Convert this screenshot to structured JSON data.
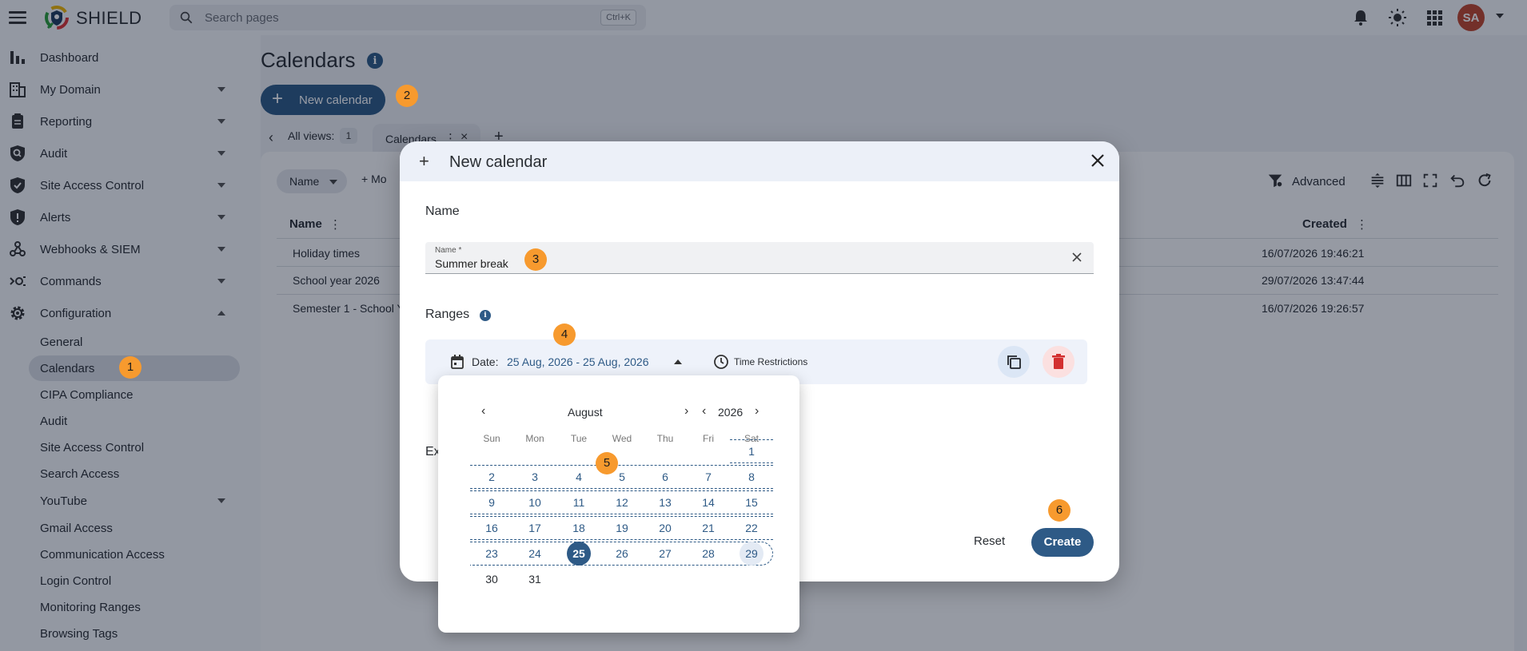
{
  "app": {
    "brand": "SHIELD",
    "avatar_initials": "SA"
  },
  "search": {
    "placeholder": "Search pages",
    "shortcut": "Ctrl+K"
  },
  "sidebar": {
    "items": [
      {
        "label": "Dashboard",
        "icon": "bar-chart-icon"
      },
      {
        "label": "My Domain",
        "icon": "building-icon"
      },
      {
        "label": "Reporting",
        "icon": "clipboard-icon"
      },
      {
        "label": "Audit",
        "icon": "shield-search-icon"
      },
      {
        "label": "Site Access Control",
        "icon": "shield-check-icon"
      },
      {
        "label": "Alerts",
        "icon": "shield-alert-icon"
      },
      {
        "label": "Webhooks & SIEM",
        "icon": "webhook-icon"
      },
      {
        "label": "Commands",
        "icon": "commands-icon"
      },
      {
        "label": "Configuration",
        "icon": "gear-icon"
      }
    ],
    "sub_items": [
      {
        "label": "General"
      },
      {
        "label": "Calendars"
      },
      {
        "label": "CIPA Compliance"
      },
      {
        "label": "Audit"
      },
      {
        "label": "Site Access Control"
      },
      {
        "label": "Search Access"
      },
      {
        "label": "YouTube"
      },
      {
        "label": "Gmail Access"
      },
      {
        "label": "Communication Access"
      },
      {
        "label": "Login Control"
      },
      {
        "label": "Monitoring Ranges"
      },
      {
        "label": "Browsing Tags"
      }
    ]
  },
  "page": {
    "title": "Calendars",
    "info_glyph": "i",
    "new_button": "New calendar",
    "views_label": "All views:",
    "views_count": "1",
    "tab_label": "Calendars",
    "filter_chip": "Name",
    "more_filters": "Mo",
    "advanced_label": "Advanced"
  },
  "table": {
    "headers": {
      "name": "Name",
      "created": "Created"
    },
    "rows": [
      {
        "name": "Holiday times",
        "created": "16/07/2026 19:46:21"
      },
      {
        "name": "School year 2026",
        "created": "29/07/2026 13:47:44"
      },
      {
        "name": "Semester 1 - School Y",
        "created": "16/07/2026 19:26:57"
      }
    ]
  },
  "dialog": {
    "title": "New calendar",
    "name_section": "Name",
    "name_field_label": "Name *",
    "name_field_value": "Summer break",
    "ranges_section": "Ranges",
    "date_label": "Date:",
    "date_value": "25 Aug, 2026 - 25 Aug, 2026",
    "time_restrictions": "Time Restrictions",
    "exceptions_section_partial": "Ex",
    "reset": "Reset",
    "create": "Create"
  },
  "picker": {
    "month": "August",
    "year": "2026",
    "weekdays": [
      "Sun",
      "Mon",
      "Tue",
      "Wed",
      "Thu",
      "Fri",
      "Sat"
    ],
    "weeks": [
      [
        "",
        "",
        "",
        "",
        "",
        "",
        "1"
      ],
      [
        "2",
        "3",
        "4",
        "5",
        "6",
        "7",
        "8"
      ],
      [
        "9",
        "10",
        "11",
        "12",
        "13",
        "14",
        "15"
      ],
      [
        "16",
        "17",
        "18",
        "19",
        "20",
        "21",
        "22"
      ],
      [
        "23",
        "24",
        "25",
        "26",
        "27",
        "28",
        "29"
      ],
      [
        "30",
        "31",
        "",
        "",
        "",
        "",
        ""
      ]
    ],
    "selected_day": "25",
    "hovered_day": "29"
  },
  "steps": [
    "1",
    "2",
    "3",
    "4",
    "5",
    "6"
  ],
  "colors": {
    "primary": "#2e5a86",
    "step_marker": "#f79a2e",
    "avatar": "#c0462c",
    "danger": "#d32f2f"
  }
}
